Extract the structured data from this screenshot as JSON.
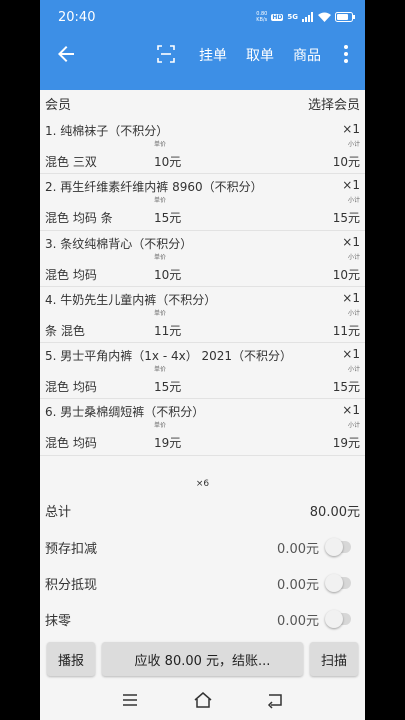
{
  "status_bar": {
    "time": "20:40",
    "speed_value": "0.80",
    "speed_unit": "KB/s",
    "hd": "HD",
    "network": "5G",
    "battery": "battery-icon"
  },
  "toolbar": {
    "back_icon": "arrow-left-icon",
    "scan_icon": "scan-frame-icon",
    "hold_label": "挂单",
    "retrieve_label": "取单",
    "products_label": "商品",
    "more_icon": "more-vert-icon"
  },
  "member": {
    "label": "会员",
    "select_label": "选择会员"
  },
  "list_labels": {
    "unit_price": "单价",
    "subtotal": "小计"
  },
  "items": [
    {
      "name": "1.  纯棉袜子（不积分）",
      "qty": "×1",
      "spec": "混色 三双",
      "price": "10元",
      "subtotal": "10元"
    },
    {
      "name": "2.  再生纤维素纤维内裤 8960（不积分）",
      "qty": "×1",
      "spec": "混色 均码 条",
      "price": "15元",
      "subtotal": "15元"
    },
    {
      "name": "3.  条纹纯棉背心（不积分）",
      "qty": "×1",
      "spec": "混色 均码",
      "price": "10元",
      "subtotal": "10元"
    },
    {
      "name": "4.  牛奶先生儿童内裤（不积分）",
      "qty": "×1",
      "spec": "条 混色",
      "price": "11元",
      "subtotal": "11元"
    },
    {
      "name": "5.  男士平角内裤（1x - 4x） 2021（不积分）",
      "qty": "×1",
      "spec": "混色 均码",
      "price": "15元",
      "subtotal": "15元"
    },
    {
      "name": "6.  男士桑棉绸短裤（不积分）",
      "qty": "×1",
      "spec": "混色 均码",
      "price": "19元",
      "subtotal": "19元"
    }
  ],
  "item_count": "×6",
  "summary": {
    "total_label": "总计",
    "total_value": "80.00元",
    "prepaid_label": "预存扣减",
    "prepaid_value": "0.00元",
    "prepaid_on": false,
    "points_label": "积分抵现",
    "points_value": "0.00元",
    "points_on": false,
    "rounding_label": "抹零",
    "rounding_value": "0.00元",
    "rounding_on": false
  },
  "actions": {
    "announce_label": "播报",
    "checkout_label": "应收 80.00 元，结账...",
    "scan_label": "扫描"
  },
  "nav": {
    "menu_icon": "menu-icon",
    "home_icon": "home-icon",
    "back_icon": "back-icon"
  },
  "colors": {
    "accent": "#3d8fe6",
    "background": "#f5f5f5",
    "button": "#dcdcdc"
  }
}
